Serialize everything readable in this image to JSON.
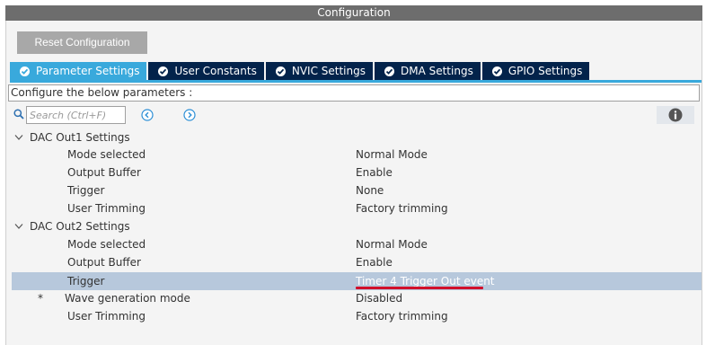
{
  "window": {
    "title": "Configuration"
  },
  "toolbar": {
    "reset_label": "Reset Configuration"
  },
  "tabs": [
    {
      "label": "Parameter Settings",
      "active": true
    },
    {
      "label": "User Constants",
      "active": false
    },
    {
      "label": "NVIC Settings",
      "active": false
    },
    {
      "label": "DMA Settings",
      "active": false
    },
    {
      "label": "GPIO Settings",
      "active": false
    }
  ],
  "configure_text": "Configure the below parameters :",
  "search": {
    "placeholder": "Search (Ctrl+F)"
  },
  "icons": {
    "search": "search-icon",
    "prev": "arrow-left-circle-icon",
    "next": "arrow-right-circle-icon",
    "info": "info-icon",
    "caret": "chevron-down-icon",
    "tab_check": "check-circle-icon"
  },
  "colors": {
    "accent": "#39a9dc",
    "tab_dark": "#03234b",
    "selection": "#b7c8dc",
    "red_mark": "#d0102b"
  },
  "groups": [
    {
      "label": "DAC Out1 Settings",
      "params": [
        {
          "name": "Mode selected",
          "value": "Normal Mode"
        },
        {
          "name": "Output Buffer",
          "value": "Enable"
        },
        {
          "name": "Trigger",
          "value": "None"
        },
        {
          "name": "User Trimming",
          "value": "Factory trimming"
        }
      ]
    },
    {
      "label": "DAC Out2 Settings",
      "params": [
        {
          "name": "Mode selected",
          "value": "Normal Mode"
        },
        {
          "name": "Output Buffer",
          "value": "Enable"
        },
        {
          "name": "Trigger",
          "value": "Timer 4 Trigger Out event",
          "selected": true
        },
        {
          "name": "Wave generation mode",
          "value": "Disabled",
          "marker": "*"
        },
        {
          "name": "User Trimming",
          "value": "Factory trimming"
        }
      ]
    }
  ]
}
